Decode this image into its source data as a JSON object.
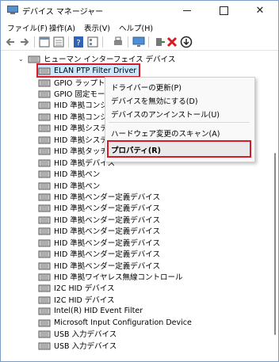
{
  "window": {
    "title": "デバイス マネージャー",
    "accent_color": "#d61b26",
    "selection_color": "#cce8ff"
  },
  "menubar": [
    "ファイル(F)",
    "操作(A)",
    "表示(V)",
    "ヘルプ(H)"
  ],
  "toolbar_icons": [
    "back-icon",
    "forward-icon",
    "properties-panel-icon",
    "computer-list-icon",
    "help-icon",
    "device-list-icon",
    "print-icon",
    "monitor-icon",
    "enable-device-icon",
    "uninstall-x-icon",
    "download-driver-icon"
  ],
  "tree": {
    "category": "ヒューマン インターフェイス デバイス",
    "items": [
      "ELAN PTP Filter Driver",
      "GPIO ラップトップま",
      "GPIO 固定モード-",
      "HID 準拠コンシュー",
      "HID 準拠コンシュー",
      "HID 準拠システム",
      "HID 準拠システム",
      "HID 準拠タッチ ス",
      "HID 準拠デバイス",
      "HID 準拠ペン",
      "HID 準拠ペン",
      "HID 準拠ベンダー定義デバイス",
      "HID 準拠ベンダー定義デバイス",
      "HID 準拠ベンダー定義デバイス",
      "HID 準拠ベンダー定義デバイス",
      "HID 準拠ベンダー定義デバイス",
      "HID 準拠ベンダー定義デバイス",
      "HID 準拠ベンダー定義デバイス",
      "HID 準拠ワイヤレス無線コントロール",
      "I2C HID デバイス",
      "I2C HID デバイス",
      "Intel(R) HID Event Filter",
      "Microsoft Input Configuration Device",
      "USB 入力デバイス",
      "USB 入力デバイス"
    ]
  },
  "context_menu": {
    "update_driver": "ドライバーの更新(P)",
    "disable_device": "デバイスを無効にする(D)",
    "uninstall_device": "デバイスのアンインストール(U)",
    "scan_hardware": "ハードウェア変更のスキャン(A)",
    "properties": "プロパティ(R)"
  }
}
